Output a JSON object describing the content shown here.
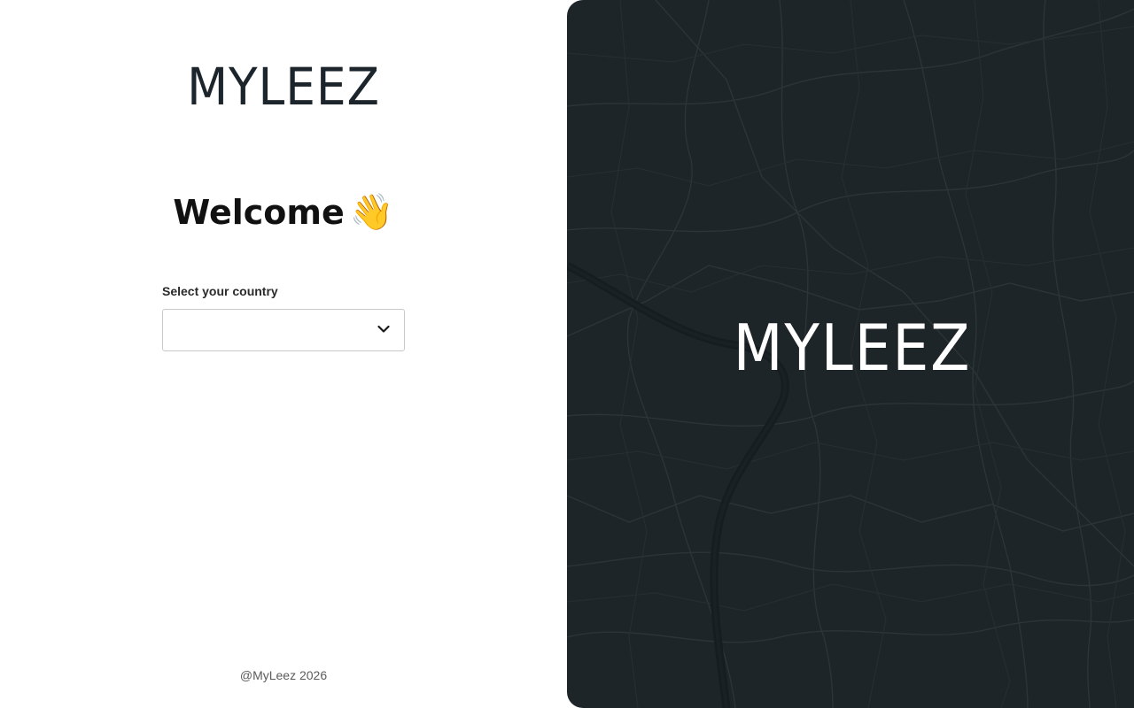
{
  "brand": {
    "logo_text": "MYLEEZ"
  },
  "login": {
    "welcome_text": "Welcome",
    "welcome_emoji": "👋",
    "country_label": "Select your country",
    "country_value": ""
  },
  "footer": {
    "copyright": "@MyLeez 2026"
  },
  "colors": {
    "dark_panel": "#1e2528",
    "logo_dark": "#1c252b",
    "map_lines": "#2d3539"
  },
  "icons": {
    "select_chevron": "chevron-down-icon",
    "welcome_wave": "waving-hand-icon"
  }
}
